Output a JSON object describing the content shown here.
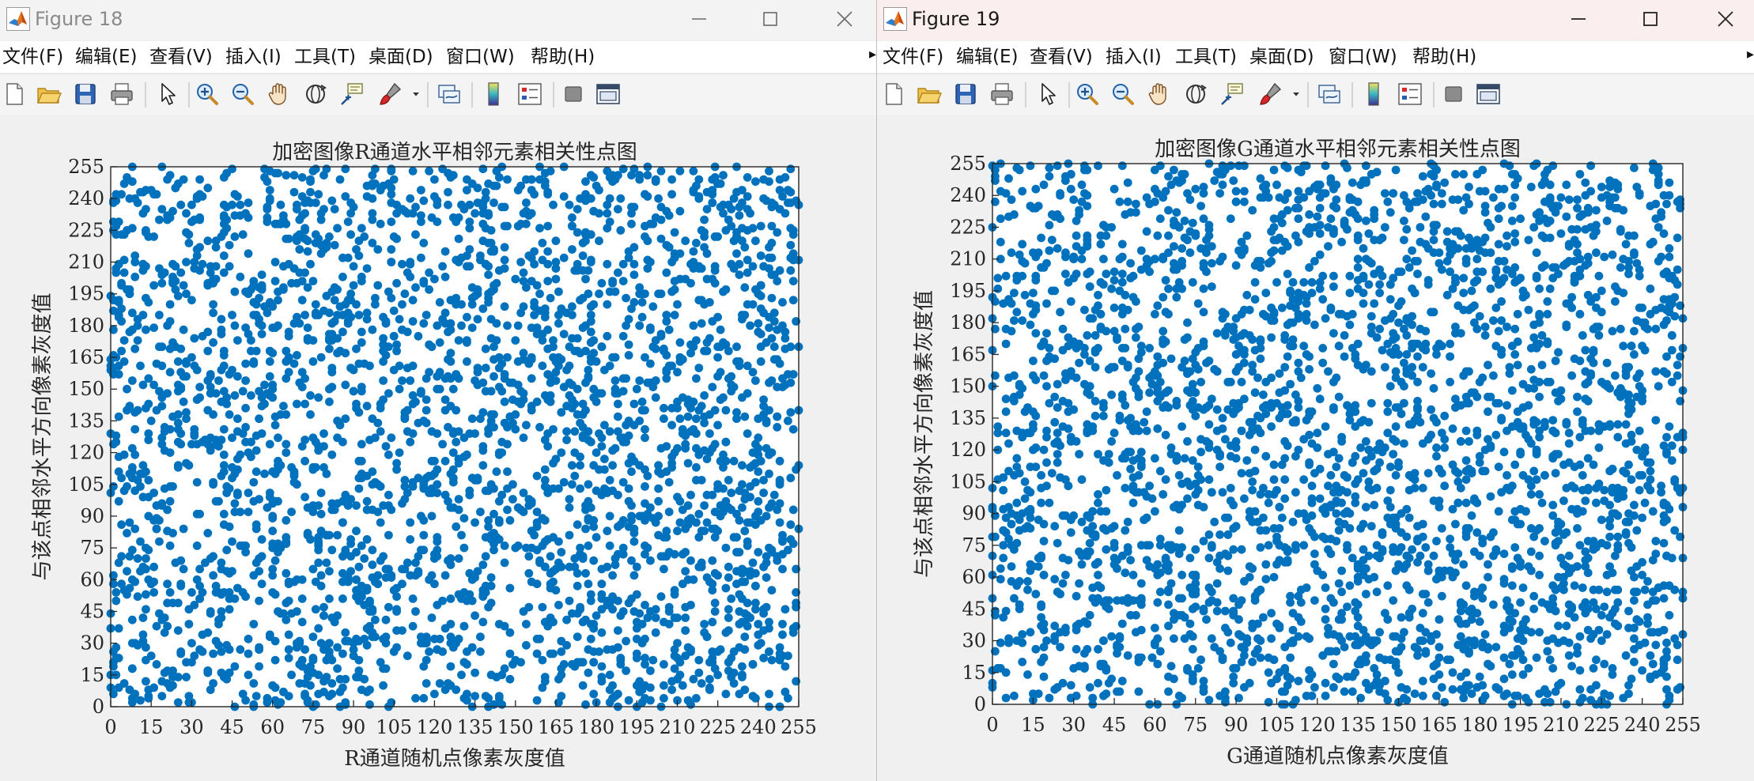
{
  "window1": {
    "title": "Figure 18",
    "menu": [
      "文件(F)",
      "编辑(E)",
      "查看(V)",
      "插入(I)",
      "工具(T)",
      "桌面(D)",
      "窗口(W)",
      "帮助(H)"
    ],
    "menu_overflow": "▸"
  },
  "window2": {
    "title": "Figure 19",
    "menu": [
      "文件(F)",
      "编辑(E)",
      "查看(V)",
      "插入(I)",
      "工具(T)",
      "桌面(D)",
      "窗口(W)",
      "帮助(H)"
    ],
    "menu_overflow": "▸"
  },
  "toolbar_icons": [
    "new-figure-icon",
    "open-folder-icon",
    "save-icon",
    "print-icon",
    "pointer-icon",
    "zoom-in-icon",
    "zoom-out-icon",
    "pan-hand-icon",
    "rotate-3d-icon",
    "data-cursor-icon",
    "brush-icon",
    "brush-dropdown-icon",
    "link-plot-icon",
    "colorbar-icon",
    "legend-icon",
    "hide-plot-tools-icon",
    "show-plot-tools-icon"
  ],
  "colors": {
    "marker": "#0072bd",
    "axes": "#262626",
    "background": "#ffffff"
  },
  "chart_data": [
    {
      "type": "scatter",
      "title": "加密图像R通道水平相邻元素相关性点图",
      "xlabel": "R通道随机点像素灰度值",
      "ylabel": "与该点相邻水平方向像素灰度值",
      "xlim": [
        0,
        255
      ],
      "ylim": [
        0,
        255
      ],
      "xticks": [
        "0",
        "15",
        "30",
        "45",
        "60",
        "75",
        "90",
        "105",
        "120",
        "135",
        "150",
        "165",
        "180",
        "195",
        "210",
        "225",
        "240",
        "255"
      ],
      "yticks": [
        "0",
        "15",
        "30",
        "45",
        "60",
        "75",
        "90",
        "105",
        "120",
        "135",
        "150",
        "165",
        "180",
        "195",
        "210",
        "225",
        "240",
        "255"
      ],
      "grid": false,
      "point_count": 3000,
      "seed": 18,
      "marker_color": "#0072bd"
    },
    {
      "type": "scatter",
      "title": "加密图像G通道水平相邻元素相关性点图",
      "xlabel": "G通道随机点像素灰度值",
      "ylabel": "与该点相邻水平方向像素灰度值",
      "xlim": [
        0,
        255
      ],
      "ylim": [
        0,
        255
      ],
      "xticks": [
        "0",
        "15",
        "30",
        "45",
        "60",
        "75",
        "90",
        "105",
        "120",
        "135",
        "150",
        "165",
        "180",
        "195",
        "210",
        "225",
        "240",
        "255"
      ],
      "yticks": [
        "0",
        "15",
        "30",
        "45",
        "60",
        "75",
        "90",
        "105",
        "120",
        "135",
        "150",
        "165",
        "180",
        "195",
        "210",
        "225",
        "240",
        "255"
      ],
      "grid": false,
      "point_count": 3000,
      "seed": 19,
      "marker_color": "#0072bd"
    }
  ]
}
